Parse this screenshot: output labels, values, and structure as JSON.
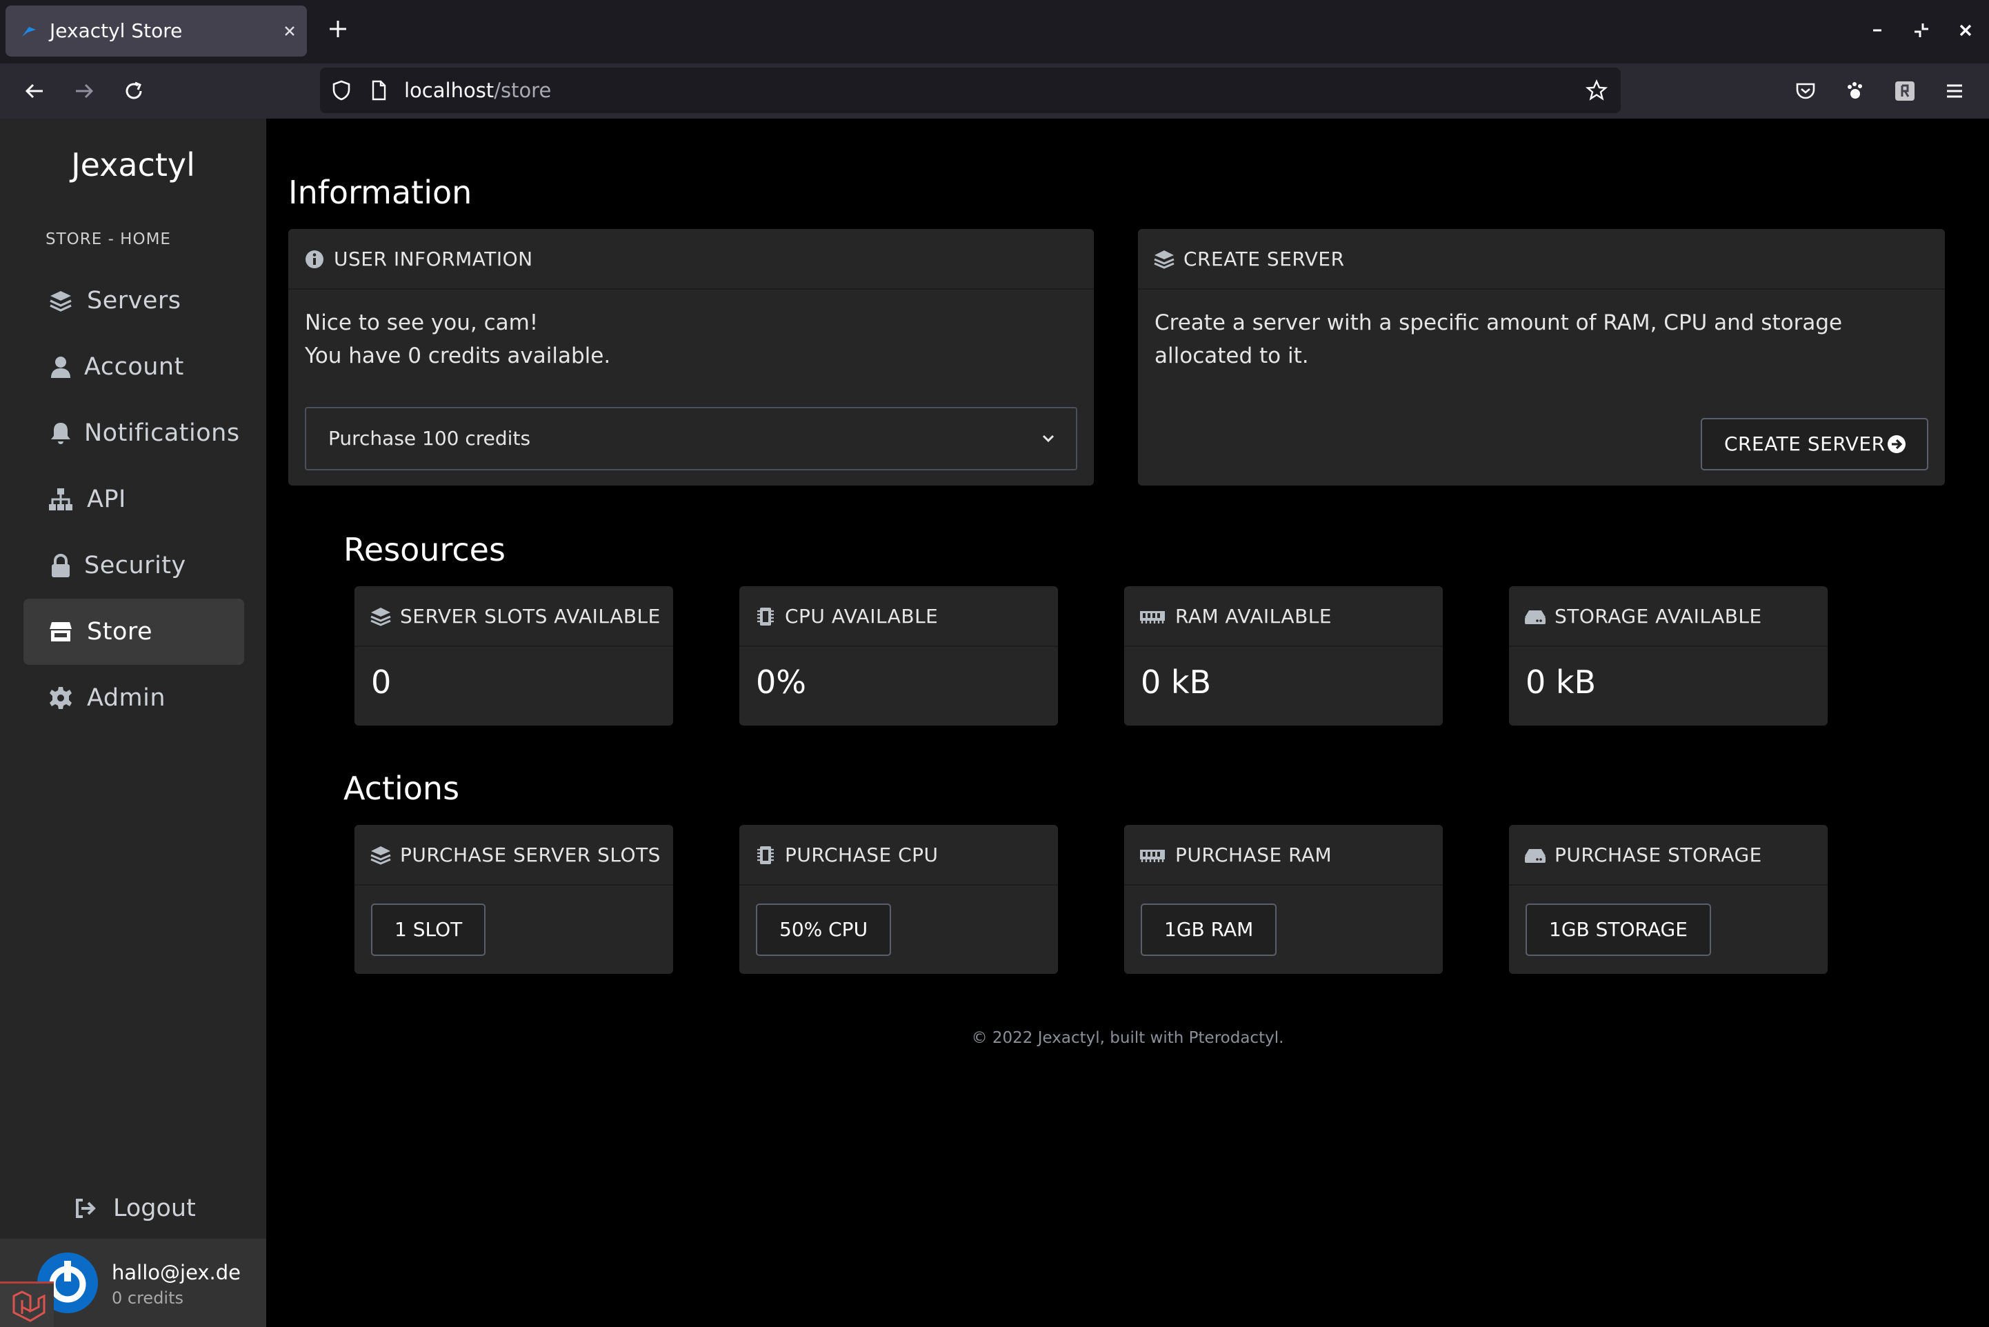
{
  "browser": {
    "tab_title": "Jexactyl Store",
    "url_host": "localhost",
    "url_path": "/store"
  },
  "sidebar": {
    "brand": "Jexactyl",
    "section_label": "STORE - HOME",
    "items": [
      {
        "label": "Servers",
        "icon": "layer-group-icon"
      },
      {
        "label": "Account",
        "icon": "user-icon"
      },
      {
        "label": "Notifications",
        "icon": "bell-icon"
      },
      {
        "label": "API",
        "icon": "sitemap-icon"
      },
      {
        "label": "Security",
        "icon": "lock-icon"
      },
      {
        "label": "Store",
        "icon": "store-icon",
        "active": true
      },
      {
        "label": "Admin",
        "icon": "cog-icon"
      }
    ],
    "logout_label": "Logout",
    "user": {
      "email": "hallo@jex.de",
      "credits": "0 credits"
    }
  },
  "information": {
    "heading": "Information",
    "user_info": {
      "title": "USER INFORMATION",
      "greeting": "Nice to see you, cam!",
      "credits_line": "You have 0 credits available.",
      "purchase_selected": "Purchase 100 credits"
    },
    "create_server": {
      "title": "CREATE SERVER",
      "description_line1": "Create a server with a specific amount of RAM, CPU and storage",
      "description_line2": "allocated to it.",
      "button_label": "CREATE SERVER"
    }
  },
  "resources": {
    "heading": "Resources",
    "cards": [
      {
        "title": "SERVER SLOTS AVAILABLE",
        "value": "0",
        "icon": "layer-group-icon"
      },
      {
        "title": "CPU AVAILABLE",
        "value": "0%",
        "icon": "microchip-icon"
      },
      {
        "title": "RAM AVAILABLE",
        "value": "0 kB",
        "icon": "memory-icon"
      },
      {
        "title": "STORAGE AVAILABLE",
        "value": "0 kB",
        "icon": "hdd-icon"
      }
    ]
  },
  "actions": {
    "heading": "Actions",
    "cards": [
      {
        "title": "PURCHASE SERVER SLOTS",
        "button": "1 SLOT",
        "icon": "layer-group-icon"
      },
      {
        "title": "PURCHASE CPU",
        "button": "50% CPU",
        "icon": "microchip-icon"
      },
      {
        "title": "PURCHASE RAM",
        "button": "1GB RAM",
        "icon": "memory-icon"
      },
      {
        "title": "PURCHASE STORAGE",
        "button": "1GB STORAGE",
        "icon": "hdd-icon"
      }
    ]
  },
  "footer": "© 2022 Jexactyl, built with Pterodactyl.",
  "colors": {
    "sidebar_bg": "#262626",
    "card_bg": "#262626",
    "page_bg": "#000000",
    "active_item_bg": "#3a3a3a"
  }
}
